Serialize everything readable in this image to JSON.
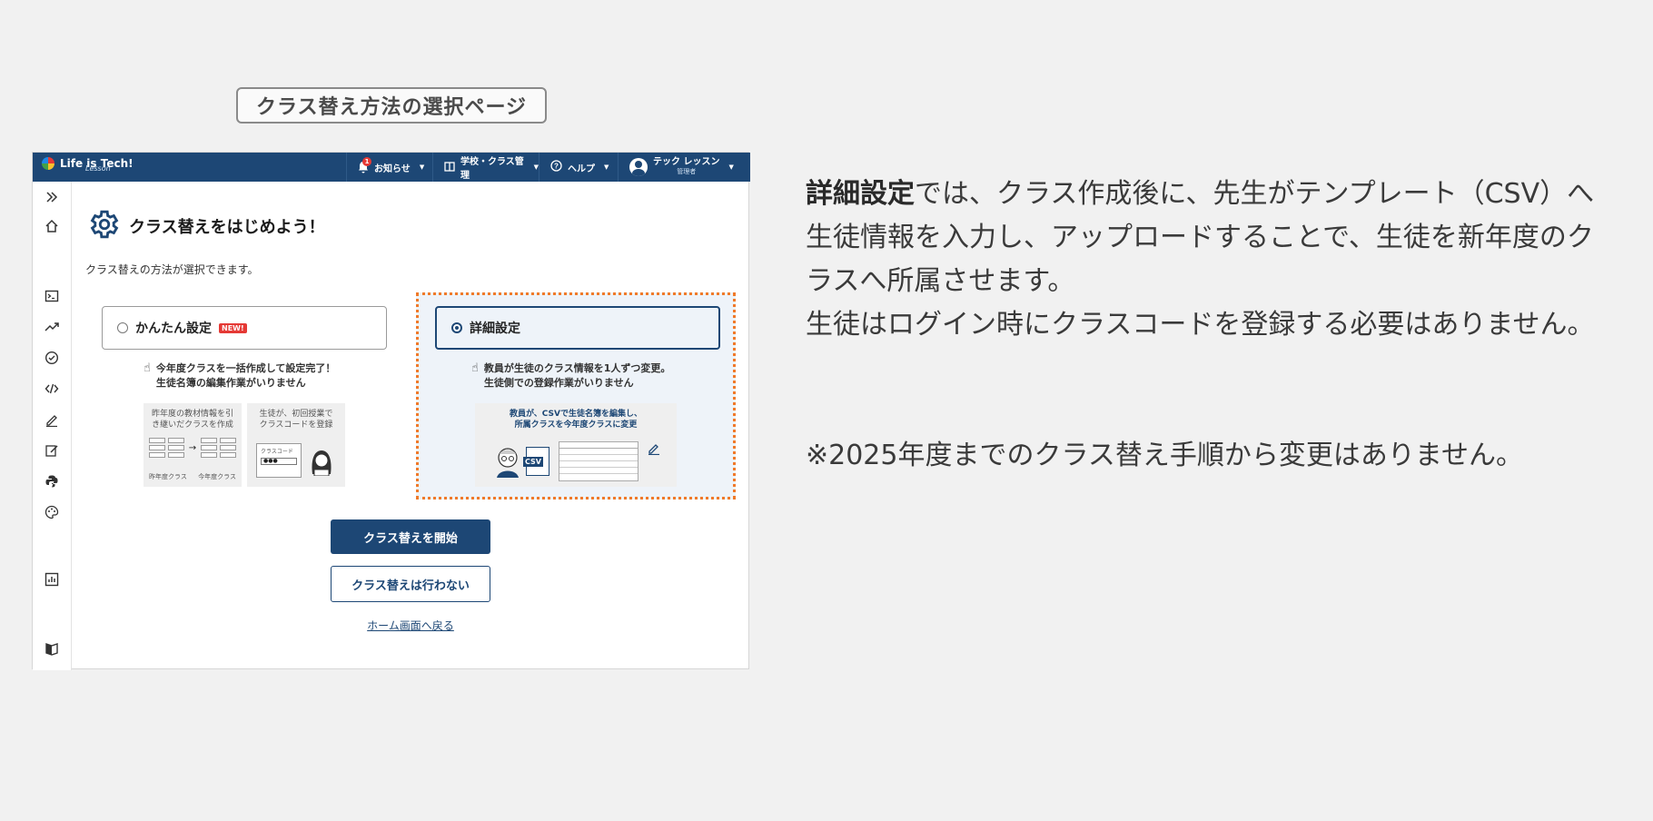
{
  "page_label": "クラス替え方法の選択ページ",
  "topbar": {
    "logo_text": "Life is Tech!",
    "logo_sub": "Lesson",
    "notification_count": "1",
    "notifications_label": "お知らせ",
    "school_label": "学校・クラス管理",
    "help_label": "ヘルプ",
    "user_name": "テック レッスン",
    "user_role": "管理者"
  },
  "sidebar": {
    "icons": [
      "expand-icon",
      "home-icon",
      "terminal-icon",
      "trending-icon",
      "check-circle-icon",
      "code-icon",
      "pen-icon",
      "edit-icon",
      "python-icon",
      "palette-icon",
      "chart-icon",
      "book-icon"
    ]
  },
  "main": {
    "title": "クラス替えをはじめよう！",
    "subtitle": "クラス替えの方法が選択できます。",
    "simple_option": {
      "label": "かんたん設定",
      "badge": "NEW!",
      "desc_line1": "今年度クラスを一括作成して設定完了！",
      "desc_line2": "生徒名簿の編集作業がいりません",
      "illus1_line1": "昨年度の教材情報を引",
      "illus1_line2": "き継いだクラスを作成",
      "illus1_from": "昨年度クラス",
      "illus1_to": "今年度クラス",
      "illus2_line1": "生徒が、初回授業で",
      "illus2_line2": "クラスコードを登録",
      "illus2_field": "クラスコード"
    },
    "detail_option": {
      "label": "詳細設定",
      "desc_line1": "教員が生徒のクラス情報を1人ずつ変更。",
      "desc_line2": "生徒側での登録作業がいりません",
      "illus_line1": "教員が、CSVで生徒名簿を編集し、",
      "illus_line2": "所属クラスを今年度クラスに変更",
      "csv_label": "CSV"
    },
    "start_button": "クラス替えを開始",
    "skip_button": "クラス替えは行わない",
    "home_link": "ホーム画面へ戻る"
  },
  "explanation": {
    "bold": "詳細設定",
    "text1": "では、クラス作成後に、先生がテンプレート（CSV）へ生徒情報を入力し、アップロードすることで、生徒を新年度のクラスへ所属させます。",
    "text2": "生徒はログイン時にクラスコードを登録する必要はありません。",
    "note": "※2025年度までのクラス替え手順から変更はありません。"
  },
  "colors": {
    "brand": "#1d4775",
    "highlight_border": "#f07a2a",
    "badge_red": "#e53935",
    "background": "#f1f1f1"
  }
}
